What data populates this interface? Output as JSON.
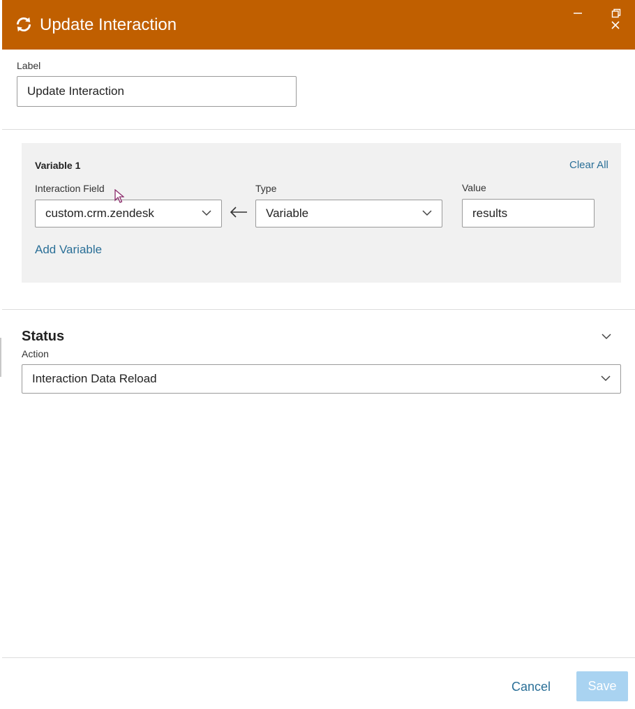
{
  "header": {
    "title": "Update Interaction",
    "icon": "refresh-icon",
    "accent_color": "#c05f00"
  },
  "label_field": {
    "label": "Label",
    "value": "Update Interaction"
  },
  "variable": {
    "heading": "Variable 1",
    "clear_all": "Clear All",
    "interaction_field_label": "Interaction Field",
    "interaction_field_value": "custom.crm.zendesk",
    "type_label": "Type",
    "type_value": "Variable",
    "value_label": "Value",
    "value_value": "results",
    "add_variable": "Add Variable"
  },
  "status": {
    "title": "Status",
    "action_label": "Action",
    "action_value": "Interaction Data Reload"
  },
  "footer": {
    "cancel": "Cancel",
    "save": "Save"
  }
}
